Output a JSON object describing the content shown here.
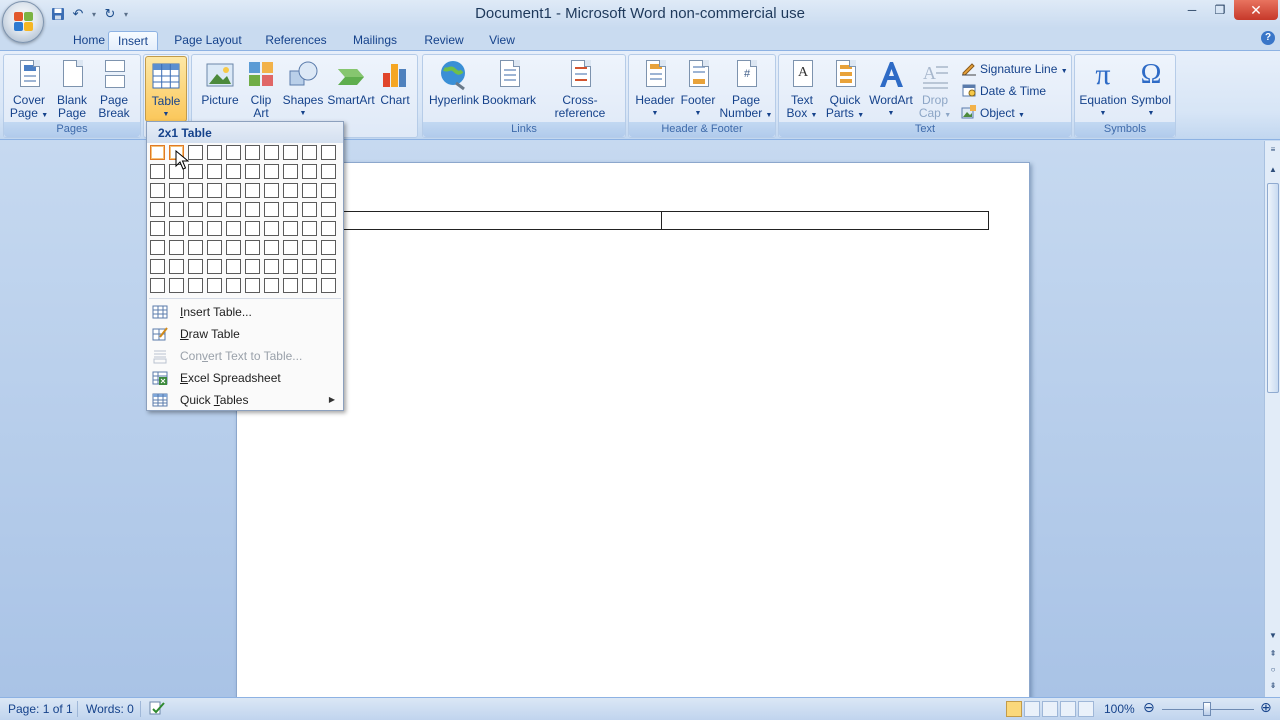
{
  "window": {
    "title": "Document1 - Microsoft Word non-commercial use",
    "minimize_glyph": "─",
    "restore_glyph": "❐",
    "close_glyph": "✕"
  },
  "qat": {
    "save": "save-icon",
    "undo": "↶",
    "redo": "↻",
    "more": "▾"
  },
  "tabs": [
    "Home",
    "Insert",
    "Page Layout",
    "References",
    "Mailings",
    "Review",
    "View"
  ],
  "active_tab": "Insert",
  "help": "?",
  "ribbon": {
    "pages": {
      "label": "Pages",
      "cover_page": [
        "Cover",
        "Page"
      ],
      "blank_page": [
        "Blank",
        "Page"
      ],
      "page_break": [
        "Page",
        "Break"
      ]
    },
    "tables": {
      "table": "Table"
    },
    "illustrations": {
      "picture": "Picture",
      "clip_art": [
        "Clip",
        "Art"
      ],
      "shapes": "Shapes",
      "smartart": "SmartArt",
      "chart": "Chart"
    },
    "links": {
      "label": "Links",
      "hyperlink": "Hyperlink",
      "bookmark": "Bookmark",
      "cross_reference": "Cross-reference"
    },
    "header_footer": {
      "label": "Header & Footer",
      "header": "Header",
      "footer": "Footer",
      "page_number": [
        "Page",
        "Number"
      ]
    },
    "text": {
      "label": "Text",
      "text_box": [
        "Text",
        "Box"
      ],
      "quick_parts": [
        "Quick",
        "Parts"
      ],
      "wordart": "WordArt",
      "drop_cap": [
        "Drop",
        "Cap"
      ],
      "signature_line": "Signature Line",
      "date_time": "Date & Time",
      "object": "Object"
    },
    "symbols": {
      "label": "Symbols",
      "equation": "Equation",
      "symbol": "Symbol",
      "pi": "π",
      "omega": "Ω"
    }
  },
  "table_menu": {
    "header": "2x1 Table",
    "grid_columns": 10,
    "grid_rows": 8,
    "selected_columns": 2,
    "selected_rows": 1,
    "items": [
      {
        "prefix": "",
        "key": "I",
        "rest": "nsert Table...",
        "enabled": true
      },
      {
        "prefix": "",
        "key": "D",
        "rest": "raw Table",
        "enabled": true
      },
      {
        "prefix": "Con",
        "key": "v",
        "rest": "ert Text to Table...",
        "enabled": false
      },
      {
        "prefix": "",
        "key": "E",
        "rest": "xcel Spreadsheet",
        "enabled": true
      },
      {
        "prefix": "Quick ",
        "key": "T",
        "rest": "ables",
        "enabled": true
      }
    ],
    "submenu_arrow": "▶"
  },
  "document": {
    "table_columns": 2,
    "table_rows": 1
  },
  "statusbar": {
    "page": "Page: 1 of 1",
    "words": "Words: 0",
    "zoom": "100%",
    "zoom_out": "⊖",
    "zoom_in": "⊕"
  },
  "scrollbar": {
    "up": "▲",
    "down": "▼",
    "prev_page": "⇞",
    "select_browse": "○",
    "next_page": "⇟"
  }
}
